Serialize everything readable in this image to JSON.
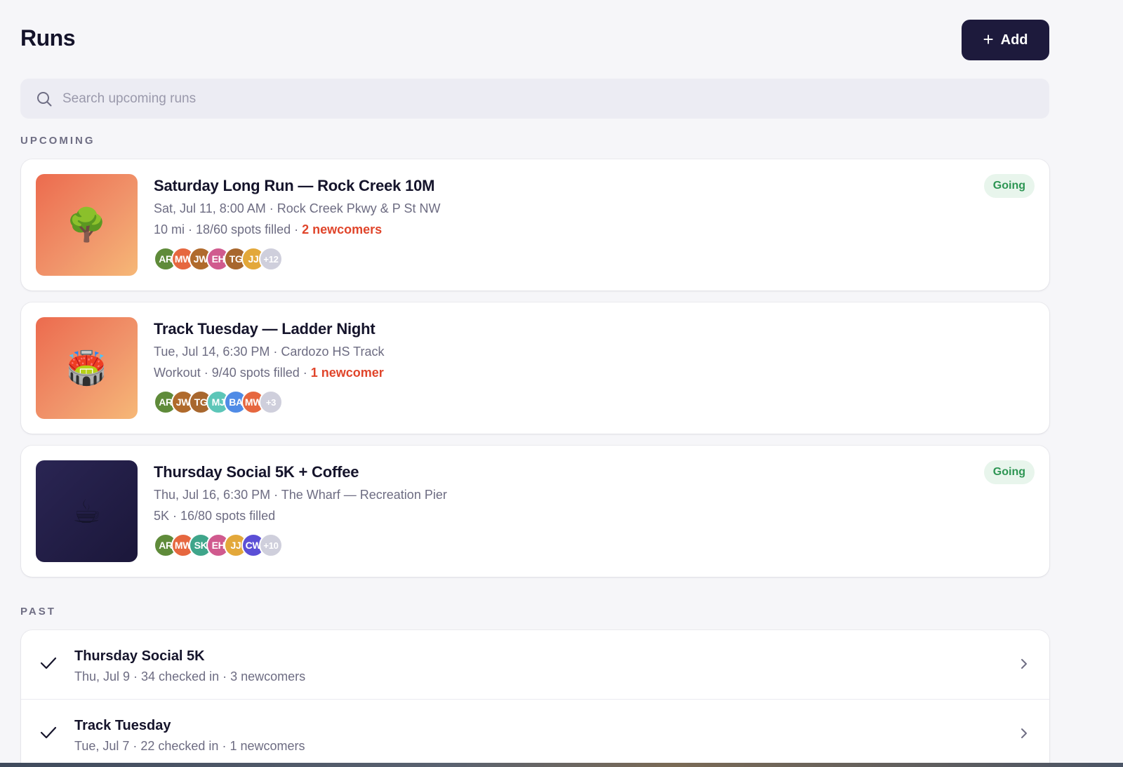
{
  "header": {
    "title": "Runs",
    "add_label": "Add",
    "add_icon": "plus-icon"
  },
  "search": {
    "placeholder": "Search upcoming runs",
    "value": "",
    "icon": "search-icon"
  },
  "sections": {
    "upcoming": "UPCOMING",
    "past": "PAST"
  },
  "upcoming": [
    {
      "title": "Saturday Long Run — Rock Creek 10M",
      "meta": "Sat, Jul 11, 8:00 AM · Rock Creek Pkwy & P St NW",
      "stats": "10 mi · 18/60 spots filled",
      "stats_sep": " · ",
      "newcomers": "2 newcomers",
      "badge": "Going",
      "thumb_emoji": "🌳",
      "thumb_style": "orange",
      "avatars": [
        {
          "initials": "AR",
          "color": "#5f8b3a"
        },
        {
          "initials": "MW",
          "color": "#e6673f"
        },
        {
          "initials": "JW",
          "color": "#b06a2c"
        },
        {
          "initials": "EH",
          "color": "#d05a8e"
        },
        {
          "initials": "TG",
          "color": "#a8672e"
        },
        {
          "initials": "JJ",
          "color": "#e3a83a"
        }
      ],
      "more": "+12"
    },
    {
      "title": "Track Tuesday — Ladder Night",
      "meta": "Tue, Jul 14, 6:30 PM · Cardozo HS Track",
      "stats": "Workout · 9/40 spots filled",
      "stats_sep": " · ",
      "newcomers": "1 newcomer",
      "badge": "",
      "thumb_emoji": "🏟️",
      "thumb_style": "orange",
      "avatars": [
        {
          "initials": "AR",
          "color": "#5f8b3a"
        },
        {
          "initials": "JW",
          "color": "#b06a2c"
        },
        {
          "initials": "TG",
          "color": "#a8672e"
        },
        {
          "initials": "MJ",
          "color": "#5cc6b8"
        },
        {
          "initials": "BA",
          "color": "#4f8be6"
        },
        {
          "initials": "MW",
          "color": "#e6673f"
        }
      ],
      "more": "+3"
    },
    {
      "title": "Thursday Social 5K + Coffee",
      "meta": "Thu, Jul 16, 6:30 PM · The Wharf — Recreation Pier",
      "stats": "5K · 16/80 spots filled",
      "stats_sep": "",
      "newcomers": "",
      "badge": "Going",
      "thumb_emoji": "☕",
      "thumb_style": "dark",
      "avatars": [
        {
          "initials": "AR",
          "color": "#5f8b3a"
        },
        {
          "initials": "MW",
          "color": "#e6673f"
        },
        {
          "initials": "SK",
          "color": "#3fa58a"
        },
        {
          "initials": "EH",
          "color": "#d05a8e"
        },
        {
          "initials": "JJ",
          "color": "#e3a83a"
        },
        {
          "initials": "CW",
          "color": "#5b4fd6"
        }
      ],
      "more": "+10"
    }
  ],
  "past": [
    {
      "title": "Thursday Social 5K",
      "meta": "Thu, Jul 9 · 34 checked in · 3 newcomers"
    },
    {
      "title": "Track Tuesday",
      "meta": "Tue, Jul 7 · 22 checked in · 1 newcomers"
    }
  ]
}
